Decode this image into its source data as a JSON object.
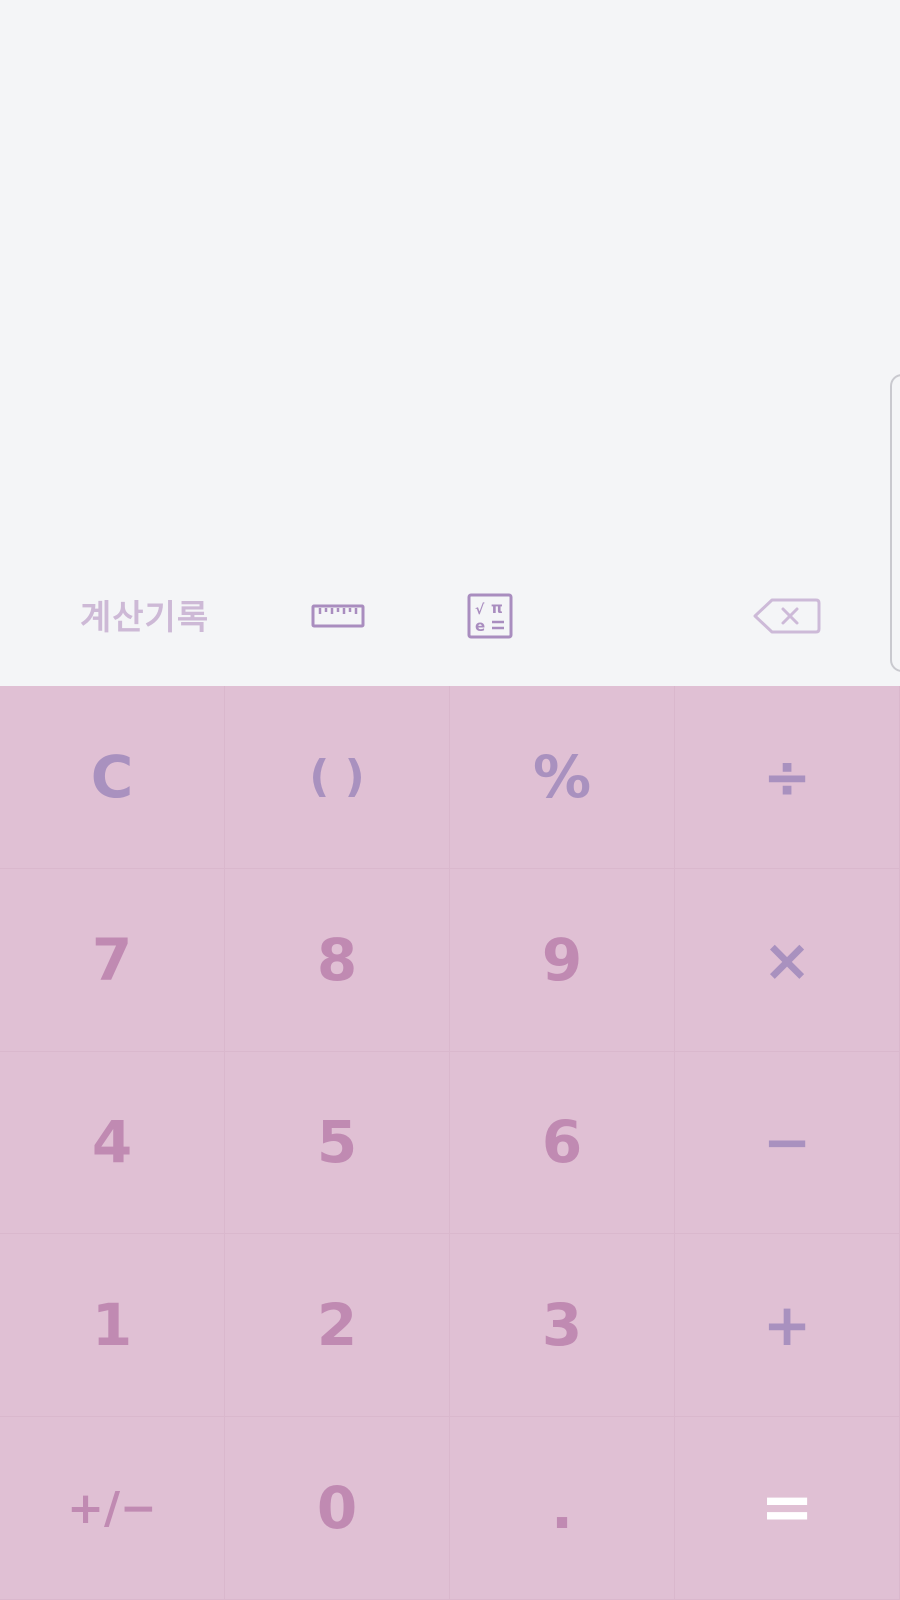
{
  "toolbar": {
    "history_label": "계산기록",
    "ruler_icon": "ruler-icon",
    "scientific_icon": "scientific-mode-icon",
    "backspace_icon": "backspace-icon"
  },
  "colors": {
    "display_bg": "#f4f5f7",
    "keypad_bg": "#e0c0d4",
    "digit": "#c08ab2",
    "operator": "#a991bf",
    "equals": "#ffffff"
  },
  "keys": {
    "clear": "C",
    "parentheses": "( )",
    "percent": "%",
    "divide": "÷",
    "seven": "7",
    "eight": "8",
    "nine": "9",
    "multiply": "×",
    "four": "4",
    "five": "5",
    "six": "6",
    "minus": "−",
    "one": "1",
    "two": "2",
    "three": "3",
    "plus": "+",
    "sign": "+/−",
    "zero": "0",
    "decimal": ".",
    "equals": "="
  }
}
